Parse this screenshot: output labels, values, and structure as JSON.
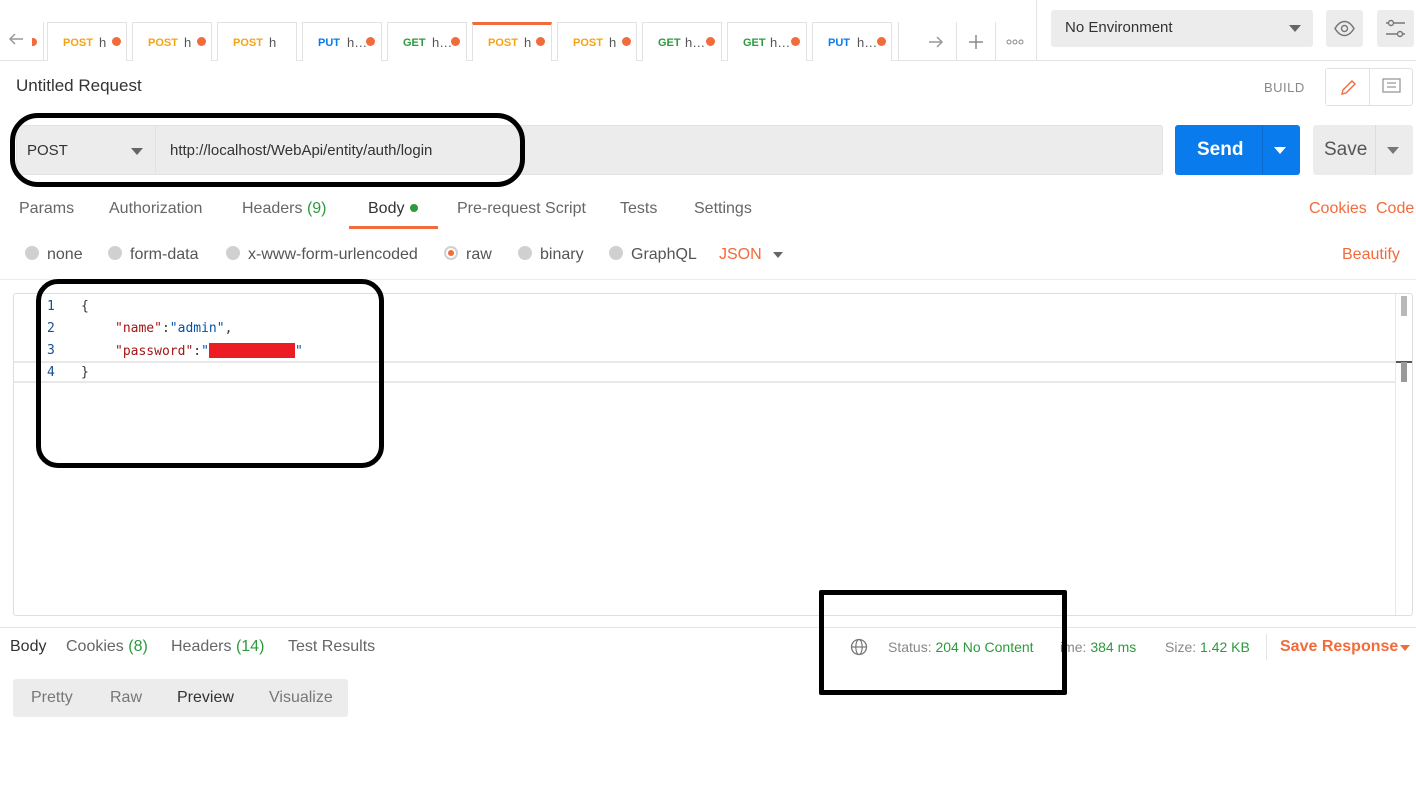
{
  "tabs": [
    {
      "method": "POST",
      "url": "h",
      "dirty": true
    },
    {
      "method": "POST",
      "url": "h",
      "dirty": true
    },
    {
      "method": "POST",
      "url": "h",
      "dirty": false
    },
    {
      "method": "PUT",
      "url": "h…",
      "dirty": true
    },
    {
      "method": "GET",
      "url": "h…",
      "dirty": true
    },
    {
      "method": "POST",
      "url": "h",
      "dirty": true,
      "active": true
    },
    {
      "method": "POST",
      "url": "h",
      "dirty": true
    },
    {
      "method": "GET",
      "url": "h…",
      "dirty": true
    },
    {
      "method": "GET",
      "url": "h…",
      "dirty": true
    },
    {
      "method": "PUT",
      "url": "h…",
      "dirty": true
    }
  ],
  "environment": {
    "selected": "No Environment"
  },
  "request": {
    "title": "Untitled Request",
    "mode_label": "BUILD",
    "method": "POST",
    "url": "http://localhost/WebApi/entity/auth/login",
    "send_label": "Send",
    "save_label": "Save"
  },
  "request_tabs": {
    "params": "Params",
    "authorization": "Authorization",
    "headers": "Headers",
    "headers_count": "(9)",
    "body": "Body",
    "prerequest": "Pre-request Script",
    "tests": "Tests",
    "settings": "Settings",
    "cookies": "Cookies",
    "code": "Code"
  },
  "body_types": {
    "none": "none",
    "form_data": "form-data",
    "urlencoded": "x-www-form-urlencoded",
    "raw": "raw",
    "binary": "binary",
    "graphql": "GraphQL",
    "format": "JSON",
    "beautify": "Beautify",
    "selected": "raw"
  },
  "editor": {
    "line_numbers": [
      "1",
      "2",
      "3",
      "4"
    ],
    "open_brace": "{",
    "close_brace": "}",
    "key_name": "\"name\"",
    "val_name": "\"admin\"",
    "key_password": "\"password\"",
    "val_password_prefix": "\"",
    "val_password_suffix": "\"",
    "colon": ":",
    "comma": ","
  },
  "response": {
    "tabs": {
      "body": "Body",
      "cookies": "Cookies",
      "cookies_count": "(8)",
      "headers": "Headers",
      "headers_count": "(14)",
      "test_results": "Test Results"
    },
    "status_label": "Status:",
    "status_value": "204 No Content",
    "time_label": "ime:",
    "time_value": "384 ms",
    "size_label": "Size:",
    "size_value": "1.42 KB",
    "save_response": "Save Response",
    "views": {
      "pretty": "Pretty",
      "raw": "Raw",
      "preview": "Preview",
      "visualize": "Visualize",
      "selected": "Preview"
    }
  },
  "colors": {
    "accent": "#f26b3a",
    "post": "#f6a313",
    "put": "#097bed",
    "get": "#2d9a3d",
    "send": "#097bed",
    "redaction": "#ec1c24"
  }
}
